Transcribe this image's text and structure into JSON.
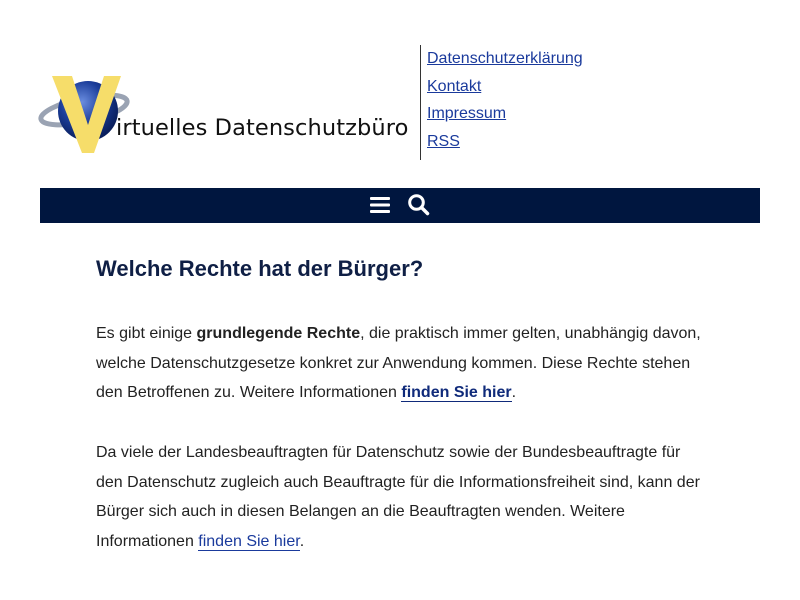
{
  "header": {
    "logo_text": "irtuelles Datenschutzbüro",
    "logo_alt": "Virtuelles Datenschutzbüro"
  },
  "topnav": {
    "items": [
      {
        "label": "Datenschutzerklärung"
      },
      {
        "label": "Kontakt"
      },
      {
        "label": "Impressum"
      },
      {
        "label": "RSS"
      }
    ]
  },
  "menubar": {
    "menu_icon": "hamburger-icon",
    "search_icon": "search-icon",
    "background": "#00163f"
  },
  "article": {
    "title": "Welche Rechte hat der Bürger?",
    "p1": {
      "before": "Es gibt einige ",
      "bold": "grundlegende Rechte",
      "middle": ", die praktisch immer gelten, unabhängig davon, welche Datenschutzgesetze konkret zur Anwendung kommen. Diese Rechte stehen den Betroffenen zu. Weitere Informationen ",
      "link": "finden Sie hier",
      "after": "."
    },
    "p2": {
      "before": "Da viele der Landesbeauftragten für Datenschutz sowie der Bundesbeauftragte für den Datenschutz zugleich auch Beauftragte für die Informationsfreiheit sind, kann der Bürger sich auch in diesen Belangen an die Beauftragten wenden. Wei­tere Informationen ",
      "link": "finden Sie hier",
      "after": "."
    }
  },
  "colors": {
    "nav_bar": "#00163f",
    "link": "#1a3a9c",
    "heading": "#0f1f45",
    "logo_yellow": "#f6dd6a",
    "logo_blue": "#1b3d9a"
  }
}
